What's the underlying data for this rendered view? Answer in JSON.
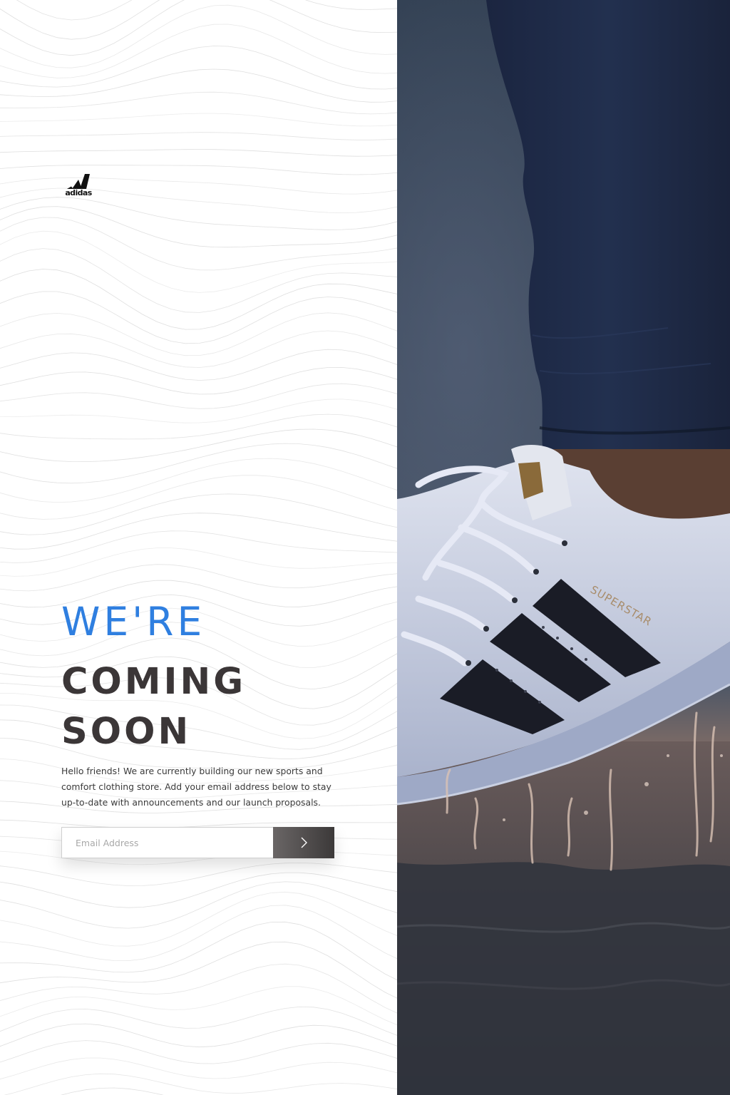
{
  "brand": {
    "logo_icon": "adidas-three-stripes-logo",
    "logo_text": "adidas"
  },
  "hero": {
    "headline_line1": "WE'RE",
    "headline_line2": "COMING",
    "headline_line3": "SOON",
    "intro": "Hello friends! We are currently building our new sports and comfort clothing store. Add your email address below to stay up-to-date with announcements and our launch proposals.",
    "accent_color": "#2f7fe0",
    "text_color": "#3b3637"
  },
  "subscribe": {
    "email_placeholder": "Email Address",
    "email_value": "",
    "submit_icon": "chevron-right-icon"
  },
  "photo": {
    "shoe_model_label": "SUPERSTAR"
  }
}
